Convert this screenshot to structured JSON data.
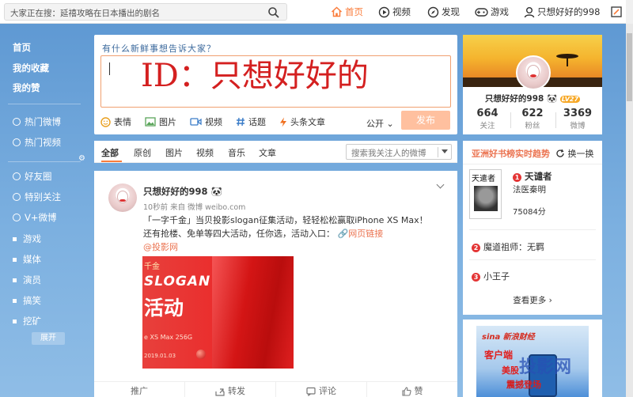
{
  "search": {
    "placeholder": "大家正在搜：延禧攻略在日本播出的剧名"
  },
  "nav": {
    "home": "首页",
    "video": "视频",
    "discover": "发现",
    "game": "游戏",
    "user": "只想好好的998"
  },
  "sidebar": {
    "items": [
      "首页",
      "我的收藏",
      "我的赞",
      "热门微博",
      "热门视频",
      "好友圈",
      "特别关注",
      "V+微博",
      "游戏",
      "媒体",
      "演员",
      "搞笑",
      "挖矿"
    ],
    "expand": "展开"
  },
  "composer": {
    "hint": "有什么新鲜事想告诉大家？",
    "typed_text": "ID：只想好好的",
    "tools": [
      "表情",
      "图片",
      "视频",
      "话题",
      "头条文章"
    ],
    "visibility": "公开",
    "post_label": "发布"
  },
  "feed_tabs": {
    "items": [
      "全部",
      "原创",
      "图片",
      "视频",
      "音乐",
      "文章"
    ],
    "search_placeholder": "搜索我关注人的微博"
  },
  "post": {
    "author": "只想好好的998",
    "meta": "10秒前 来自 微博 weibo.com",
    "line1": "「一字千金」当贝投影slogan征集活动，轻轻松松赢取iPhone XS Max！",
    "line2": "还有抢楼、免单等四大活动，任你选，活动入口：",
    "link": "网页链接",
    "mention": "@投影网",
    "image": {
      "t1": "千金",
      "t2": "SLOGAN",
      "t3": "活动",
      "t4": "e XS Max 256G",
      "t5": "2019.01.03"
    },
    "actions": [
      "推广",
      "转发",
      "评论",
      "赞"
    ]
  },
  "profile": {
    "name": "只想好好的998",
    "level": "LV27",
    "stats": [
      {
        "num": "664",
        "label": "关注"
      },
      {
        "num": "622",
        "label": "粉丝"
      },
      {
        "num": "3369",
        "label": "微博"
      }
    ]
  },
  "trending": {
    "title": "亚洲好书榜实时趋势",
    "refresh": "换一换",
    "book_title": "天遣者",
    "items": [
      {
        "rank": "1",
        "title": "天谴者",
        "author": "法医秦明",
        "count": "75084分"
      },
      {
        "rank": "2",
        "title": "魔道祖师：无羁"
      },
      {
        "rank": "3",
        "title": "小王子"
      }
    ],
    "more": "查看更多"
  },
  "ad": {
    "brand": "sina 新浪财经",
    "line1": "客户端",
    "line2": "美股",
    "line3": "震撼登场"
  },
  "watermark": "投影网",
  "colors": {
    "accent": "#fa7d3c",
    "link": "#eb7350",
    "red_text": "#d42020",
    "background_blue": "#6fa3d6"
  }
}
